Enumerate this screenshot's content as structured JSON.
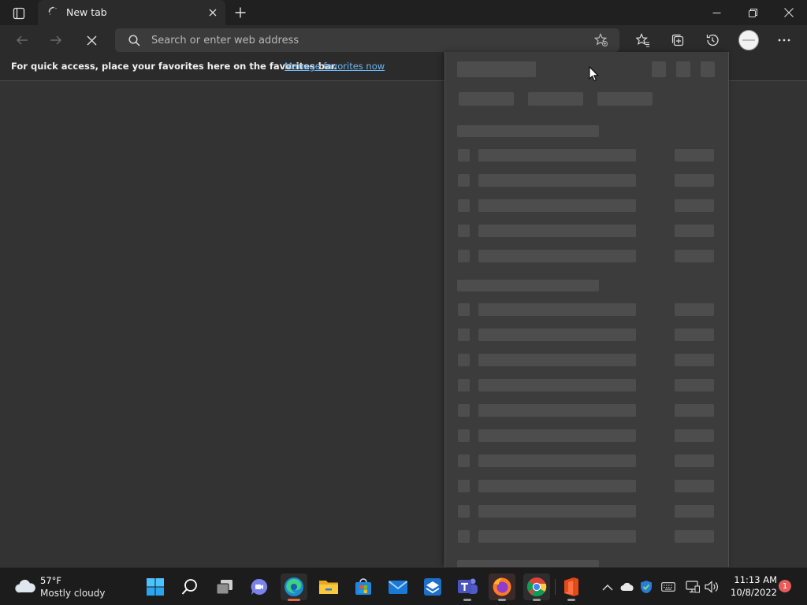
{
  "tab": {
    "title": "New tab"
  },
  "address": {
    "placeholder": "Search or enter web address"
  },
  "favbar": {
    "message": "For quick access, place your favorites here on the favorites bar.",
    "link": "Manage favorites now"
  },
  "taskbar": {
    "weather_temp": "57°F",
    "weather_condition": "Mostly cloudy",
    "clock_time": "11:13 AM",
    "clock_date": "10/8/2022",
    "notification_count": "1"
  },
  "colors": {
    "accent_link": "#6cb8f6",
    "tab_bg": "#2b2b2b",
    "titlebar_bg": "#202020",
    "content_bg": "#333333",
    "panel_bg": "#3c3c3c",
    "skeleton": "#4d4d4d",
    "taskbar_bg": "#1c1c1c"
  },
  "icons": [
    "tab-actions-icon",
    "loading-spinner-icon",
    "close-icon",
    "plus-icon",
    "minimize-icon",
    "restore-icon",
    "window-close-icon",
    "back-arrow-icon",
    "forward-arrow-icon",
    "stop-icon",
    "search-icon",
    "favorite-star-icon",
    "favorites-icon",
    "collections-icon",
    "history-icon",
    "profile-avatar",
    "more-options-icon",
    "weather-cloud-icon",
    "windows-start-icon",
    "taskbar-search-icon",
    "task-view-icon",
    "chat-icon",
    "edge-icon",
    "file-explorer-icon",
    "microsoft-store-icon",
    "mail-icon",
    "taskbar-app-icon",
    "teams-icon",
    "firefox-icon",
    "chrome-icon",
    "office-icon",
    "chevron-up-icon",
    "onedrive-icon",
    "security-shield-icon",
    "keyboard-icon",
    "network-icon",
    "volume-icon"
  ]
}
